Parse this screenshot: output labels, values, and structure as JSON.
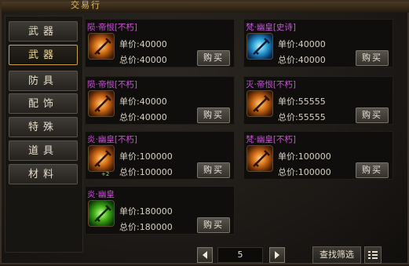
{
  "window": {
    "title": "交易行"
  },
  "categories": [
    {
      "label": "武器",
      "active": false
    },
    {
      "label": "武器",
      "active": true
    },
    {
      "label": "防具",
      "active": false
    },
    {
      "label": "配饰",
      "active": false
    },
    {
      "label": "特殊",
      "active": false
    },
    {
      "label": "道具",
      "active": false
    },
    {
      "label": "材料",
      "active": false
    }
  ],
  "labels": {
    "unit_price": "单价:",
    "total_price": "总价:",
    "buy": "购买"
  },
  "items": [
    {
      "name": "陨·帝恨[不朽]",
      "name_color": "#d24be0",
      "unit": "40000",
      "total": "40000",
      "icon": "orange-weapon-icon",
      "plus": ""
    },
    {
      "name": "梵·幽皇[史诗]",
      "name_color": "#c35ad8",
      "unit": "40000",
      "total": "40000",
      "icon": "blue-weapon-icon",
      "plus": ""
    },
    {
      "name": "陨·帝恨[不朽]",
      "name_color": "#d24be0",
      "unit": "40000",
      "total": "40000",
      "icon": "orange-weapon-icon",
      "plus": ""
    },
    {
      "name": "灭·帝恨[不朽]",
      "name_color": "#d24be0",
      "unit": "55555",
      "total": "55555",
      "icon": "orange-weapon-icon",
      "plus": ""
    },
    {
      "name": "炎·幽皇[不朽]",
      "name_color": "#d24be0",
      "unit": "100000",
      "total": "100000",
      "icon": "orange-weapon-icon",
      "plus": "+2"
    },
    {
      "name": "梵·幽皇[不朽]",
      "name_color": "#d24be0",
      "unit": "100000",
      "total": "100000",
      "icon": "orange-weapon-icon",
      "plus": ""
    },
    {
      "name": "炎·幽皇",
      "name_color": "#d24be0",
      "unit": "180000",
      "total": "180000",
      "icon": "green-weapon-icon",
      "plus": ""
    }
  ],
  "pagination": {
    "page": "5"
  },
  "search": {
    "label": "查找筛选"
  }
}
